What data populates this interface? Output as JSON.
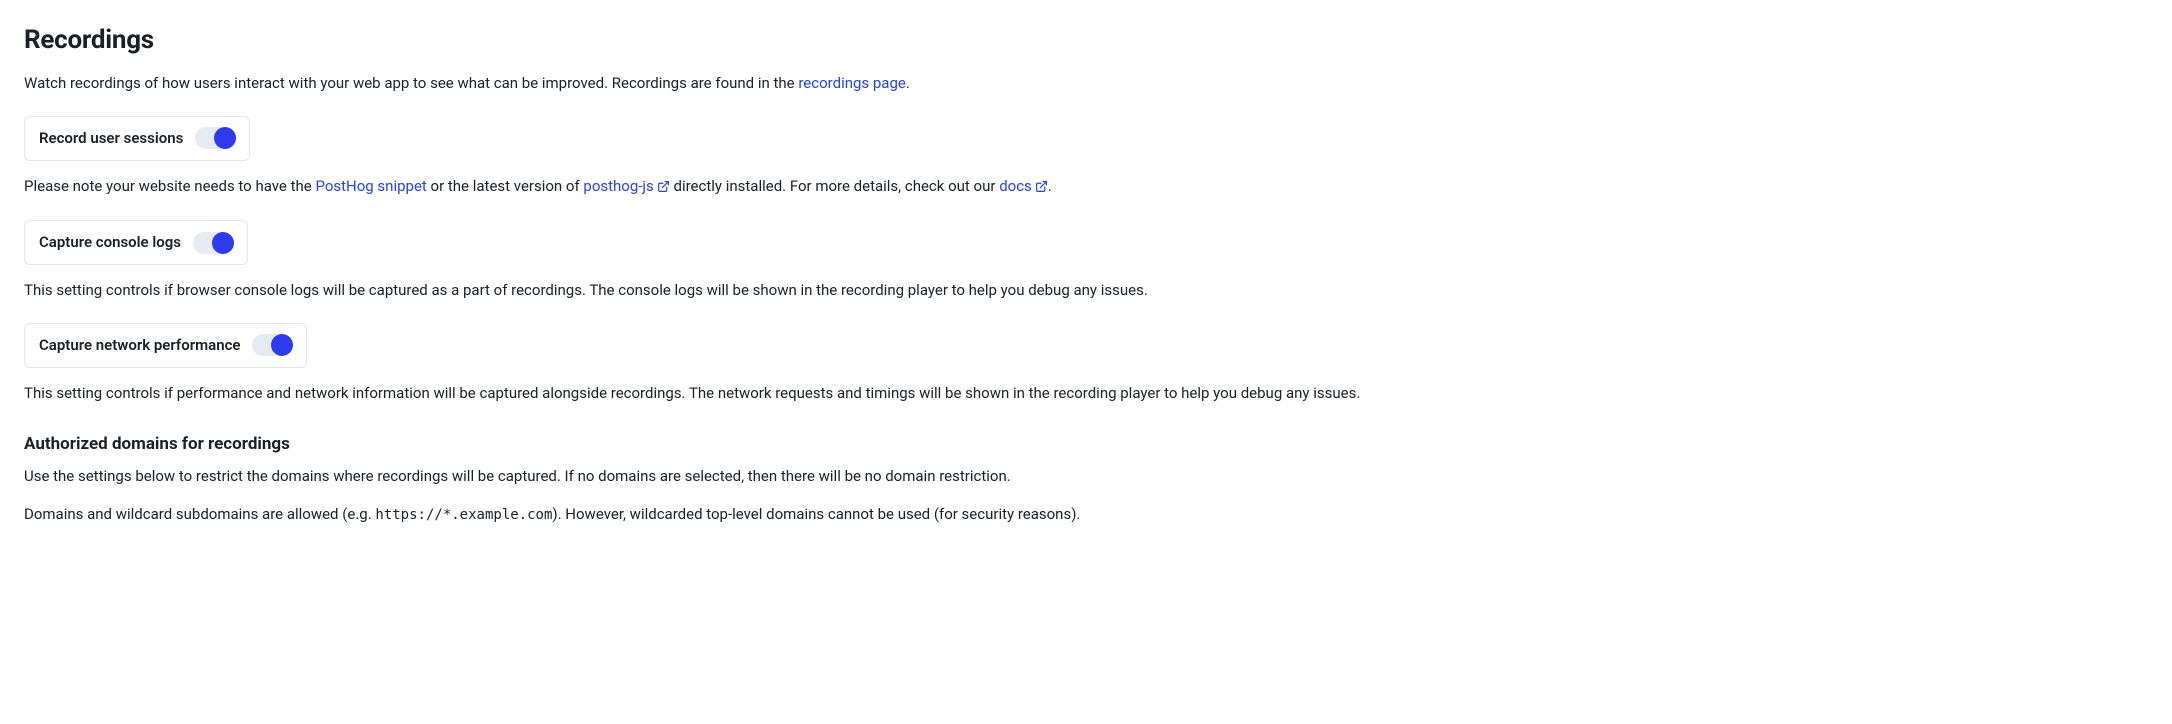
{
  "heading": "Recordings",
  "intro": {
    "part1": "Watch recordings of how users interact with your web app to see what can be improved. Recordings are found in the ",
    "link_text": "recordings page",
    "part2": "."
  },
  "toggles": {
    "record_sessions": {
      "label": "Record user sessions",
      "on": true
    },
    "console_logs": {
      "label": "Capture console logs",
      "on": true
    },
    "network_perf": {
      "label": "Capture network performance",
      "on": true
    }
  },
  "note": {
    "part1": "Please note your website needs to have the ",
    "link1": "PostHog snippet",
    "part2": " or the latest version of ",
    "link2": "posthog-js",
    "part3": " directly installed. For more details, check out our ",
    "link3": "docs",
    "part4": "."
  },
  "console_desc": "This setting controls if browser console logs will be captured as a part of recordings. The console logs will be shown in the recording player to help you debug any issues.",
  "network_desc": "This setting controls if performance and network information will be captured alongside recordings. The network requests and timings will be shown in the recording player to help you debug any issues.",
  "domains": {
    "heading": "Authorized domains for recordings",
    "desc1": "Use the settings below to restrict the domains where recordings will be captured. If no domains are selected, then there will be no domain restriction.",
    "desc2_a": "Domains and wildcard subdomains are allowed (e.g. ",
    "desc2_code": "https://*.example.com",
    "desc2_b": "). However, wildcarded top-level domains cannot be used (for security reasons)."
  }
}
